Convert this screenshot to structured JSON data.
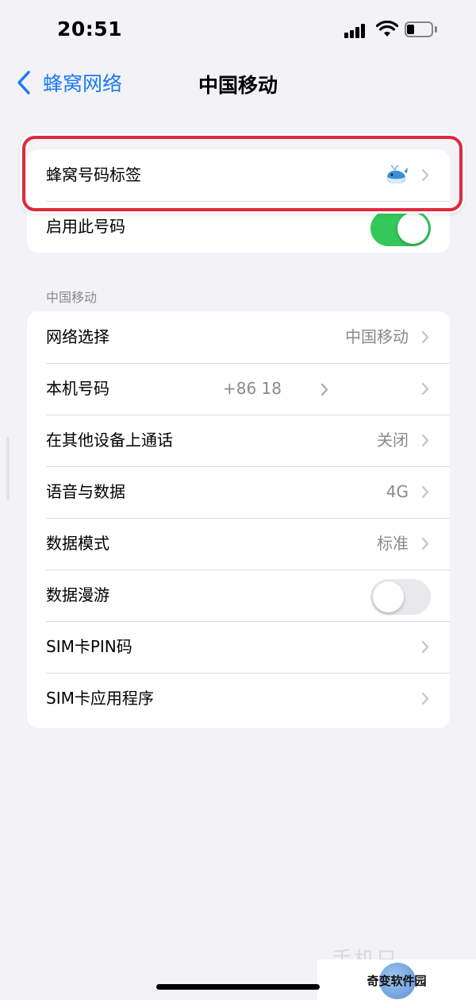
{
  "status_bar": {
    "time": "20:51"
  },
  "nav": {
    "back_label": "蜂窝网络",
    "title": "中国移动"
  },
  "top_group": {
    "rows": [
      {
        "label": "蜂窝号码标签",
        "icon": "whale-emoji"
      },
      {
        "label": "启用此号码",
        "toggle": "on"
      }
    ]
  },
  "section": {
    "header": "中国移动"
  },
  "main_group": {
    "rows": [
      {
        "label": "网络选择",
        "value": "中国移动"
      },
      {
        "label": "本机号码",
        "value": "+86 18"
      },
      {
        "label": "在其他设备上通话",
        "value": "关闭"
      },
      {
        "label": "语音与数据",
        "value": "4G"
      },
      {
        "label": "数据模式",
        "value": "标准"
      },
      {
        "label": "数据漫游",
        "toggle": "off"
      },
      {
        "label": "SIM卡PIN码",
        "value": ""
      },
      {
        "label": "SIM卡应用程序",
        "value": ""
      }
    ]
  },
  "watermark": {
    "text": "奇变软件园",
    "ghost_text": "手机只"
  },
  "colors": {
    "accent": "#1a7af0",
    "toggle_on": "#34c759",
    "highlight": "#e0283c",
    "background": "#f2f2f7"
  }
}
